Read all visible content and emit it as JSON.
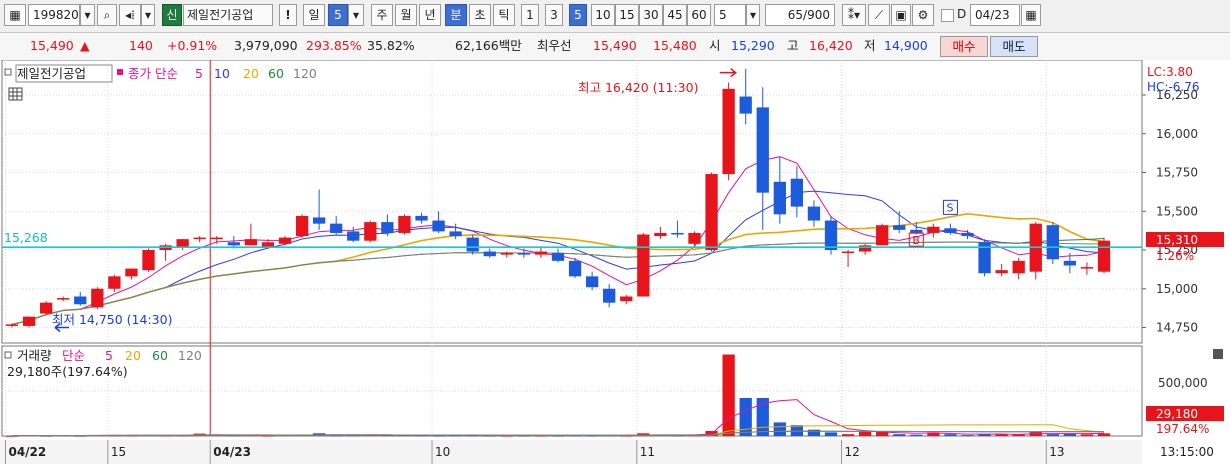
{
  "toolbar": {
    "code": "199820",
    "credit_badge": "신",
    "stock_name": "제일전기공업",
    "alert": "!",
    "periods": [
      "일",
      "5",
      "주",
      "월",
      "년",
      "분",
      "초",
      "틱"
    ],
    "active_period": "분",
    "minutes": [
      "1",
      "3",
      "5",
      "10",
      "15",
      "30",
      "45",
      "60"
    ],
    "active_minute": "5",
    "interval_value": "5",
    "count_display": "65/900",
    "date_checkbox_label": "D",
    "date_value": "04/23"
  },
  "quote": {
    "price": "15,490",
    "change": "140",
    "change_rate": "+0.91%",
    "volume": "3,979,090",
    "volume_ratio": "293.85%",
    "turnover": "35.82%",
    "amount": "62,166백만",
    "best_label": "최우선",
    "ask": "15,490",
    "bid": "15,480",
    "open_label": "시",
    "open": "15,290",
    "high_label": "고",
    "high": "16,420",
    "low_label": "저",
    "low": "14,900",
    "buy_label": "매수",
    "sell_label": "매도"
  },
  "price_panel": {
    "title": "제일전기공업",
    "ma_label": "종가 단순",
    "ma_periods": [
      "5",
      "10",
      "20",
      "60",
      "120"
    ],
    "ma_colors": [
      "#e0149c",
      "#2a3fe8",
      "#e8a800",
      "#1a8c3a",
      "#808080"
    ],
    "lc_label": "LC:3.80",
    "hc_label": "HC:-6.76",
    "max_annotation": "최고 16,420 (11:30)",
    "min_annotation": "최저 14,750 (14:30)",
    "ref_line_label": "15,268",
    "ref_line_value": 15268,
    "current_price_label": "15,310",
    "current_change_label": "1.26%",
    "signal_s": "S",
    "signal_b": "B",
    "y_ticks": [
      "16,250",
      "16,000",
      "15,750",
      "15,500",
      "15,250",
      "15,000",
      "14,750"
    ]
  },
  "volume_panel": {
    "title": "거래량",
    "ma_label": "단순",
    "ma_periods": [
      "5",
      "20",
      "60",
      "120"
    ],
    "ma_colors": [
      "#e0149c",
      "#e8a800",
      "#1a8c3a",
      "#808080"
    ],
    "last_value": "29,180주(197.64%)",
    "y_tick": "500,000",
    "current_label": "29,180",
    "ratio_label": "197.64%"
  },
  "x_axis": {
    "labels": [
      "04/22",
      "15",
      "04/23",
      "10",
      "11",
      "12",
      "13"
    ],
    "time": "13:15:00"
  },
  "chart_data": {
    "type": "candlestick",
    "interval": "5분",
    "ylim": [
      14650,
      16450
    ],
    "candles": [
      {
        "o": 14760,
        "h": 14775,
        "l": 14750,
        "c": 14770
      },
      {
        "o": 14760,
        "h": 14820,
        "l": 14750,
        "c": 14820
      },
      {
        "o": 14840,
        "h": 14920,
        "l": 14830,
        "c": 14910
      },
      {
        "o": 14930,
        "h": 14950,
        "l": 14920,
        "c": 14940
      },
      {
        "o": 14950,
        "h": 14980,
        "l": 14890,
        "c": 14900
      },
      {
        "o": 14880,
        "h": 15010,
        "l": 14870,
        "c": 15000
      },
      {
        "o": 15000,
        "h": 15090,
        "l": 14980,
        "c": 15080
      },
      {
        "o": 15080,
        "h": 15130,
        "l": 15060,
        "c": 15130
      },
      {
        "o": 15120,
        "h": 15260,
        "l": 15110,
        "c": 15250
      },
      {
        "o": 15250,
        "h": 15290,
        "l": 15180,
        "c": 15280
      },
      {
        "o": 15270,
        "h": 15320,
        "l": 15250,
        "c": 15320
      },
      {
        "o": 15320,
        "h": 15340,
        "l": 15300,
        "c": 15330
      },
      {
        "o": 15320,
        "h": 15340,
        "l": 15290,
        "c": 15330
      },
      {
        "o": 15300,
        "h": 15340,
        "l": 15260,
        "c": 15280
      },
      {
        "o": 15280,
        "h": 15420,
        "l": 15280,
        "c": 15320
      },
      {
        "o": 15270,
        "h": 15320,
        "l": 15260,
        "c": 15300
      },
      {
        "o": 15290,
        "h": 15340,
        "l": 15280,
        "c": 15330
      },
      {
        "o": 15340,
        "h": 15480,
        "l": 15330,
        "c": 15470
      },
      {
        "o": 15460,
        "h": 15640,
        "l": 15380,
        "c": 15420
      },
      {
        "o": 15420,
        "h": 15470,
        "l": 15350,
        "c": 15360
      },
      {
        "o": 15370,
        "h": 15400,
        "l": 15300,
        "c": 15310
      },
      {
        "o": 15310,
        "h": 15440,
        "l": 15300,
        "c": 15430
      },
      {
        "o": 15430,
        "h": 15480,
        "l": 15340,
        "c": 15360
      },
      {
        "o": 15360,
        "h": 15480,
        "l": 15350,
        "c": 15470
      },
      {
        "o": 15470,
        "h": 15490,
        "l": 15420,
        "c": 15440
      },
      {
        "o": 15440,
        "h": 15500,
        "l": 15360,
        "c": 15370
      },
      {
        "o": 15370,
        "h": 15420,
        "l": 15320,
        "c": 15340
      },
      {
        "o": 15330,
        "h": 15350,
        "l": 15220,
        "c": 15240
      },
      {
        "o": 15240,
        "h": 15260,
        "l": 15200,
        "c": 15210
      },
      {
        "o": 15220,
        "h": 15240,
        "l": 15200,
        "c": 15230
      },
      {
        "o": 15230,
        "h": 15260,
        "l": 15200,
        "c": 15220
      },
      {
        "o": 15220,
        "h": 15270,
        "l": 15200,
        "c": 15240
      },
      {
        "o": 15230,
        "h": 15260,
        "l": 15170,
        "c": 15180
      },
      {
        "o": 15180,
        "h": 15200,
        "l": 15070,
        "c": 15080
      },
      {
        "o": 15080,
        "h": 15110,
        "l": 14990,
        "c": 15010
      },
      {
        "o": 15000,
        "h": 15030,
        "l": 14880,
        "c": 14910
      },
      {
        "o": 14920,
        "h": 14960,
        "l": 14900,
        "c": 14950
      },
      {
        "o": 14950,
        "h": 15360,
        "l": 14950,
        "c": 15350
      },
      {
        "o": 15340,
        "h": 15400,
        "l": 15320,
        "c": 15360
      },
      {
        "o": 15360,
        "h": 15440,
        "l": 15330,
        "c": 15350
      },
      {
        "o": 15290,
        "h": 15370,
        "l": 15270,
        "c": 15360
      },
      {
        "o": 15250,
        "h": 15750,
        "l": 15240,
        "c": 15740
      },
      {
        "o": 15740,
        "h": 16330,
        "l": 15700,
        "c": 16290
      },
      {
        "o": 16240,
        "h": 16420,
        "l": 16060,
        "c": 16130
      },
      {
        "o": 16170,
        "h": 16300,
        "l": 15380,
        "c": 15620
      },
      {
        "o": 15690,
        "h": 15850,
        "l": 15420,
        "c": 15480
      },
      {
        "o": 15710,
        "h": 15790,
        "l": 15460,
        "c": 15530
      },
      {
        "o": 15530,
        "h": 15570,
        "l": 15400,
        "c": 15440
      },
      {
        "o": 15440,
        "h": 15470,
        "l": 15220,
        "c": 15250
      },
      {
        "o": 15230,
        "h": 15250,
        "l": 15140,
        "c": 15240
      },
      {
        "o": 15240,
        "h": 15290,
        "l": 15220,
        "c": 15280
      },
      {
        "o": 15280,
        "h": 15420,
        "l": 15280,
        "c": 15410
      },
      {
        "o": 15410,
        "h": 15500,
        "l": 15360,
        "c": 15380
      },
      {
        "o": 15380,
        "h": 15430,
        "l": 15350,
        "c": 15360
      },
      {
        "o": 15360,
        "h": 15420,
        "l": 15330,
        "c": 15400
      },
      {
        "o": 15390,
        "h": 15420,
        "l": 15350,
        "c": 15360
      },
      {
        "o": 15360,
        "h": 15380,
        "l": 15320,
        "c": 15340
      },
      {
        "o": 15300,
        "h": 15320,
        "l": 15080,
        "c": 15100
      },
      {
        "o": 15100,
        "h": 15160,
        "l": 15080,
        "c": 15120
      },
      {
        "o": 15100,
        "h": 15200,
        "l": 15060,
        "c": 15180
      },
      {
        "o": 15110,
        "h": 15430,
        "l": 15060,
        "c": 15420
      },
      {
        "o": 15410,
        "h": 15430,
        "l": 15160,
        "c": 15190
      },
      {
        "o": 15180,
        "h": 15230,
        "l": 15100,
        "c": 15150
      },
      {
        "o": 15130,
        "h": 15170,
        "l": 15090,
        "c": 15140
      },
      {
        "o": 15110,
        "h": 15330,
        "l": 15100,
        "c": 15310
      }
    ],
    "volumes": [
      2200,
      7000,
      4000,
      9000,
      4200,
      9800,
      8000,
      7500,
      10500,
      6000,
      7000,
      26000,
      14500,
      7000,
      8500,
      5000,
      10000,
      15000,
      30000,
      7000,
      8000,
      12000,
      9000,
      10000,
      8000,
      5000,
      6000,
      7000,
      5000,
      4500,
      5000,
      5000,
      4500,
      6000,
      5000,
      7000,
      5000,
      30000,
      12500,
      7000,
      8000,
      55000,
      900000,
      420000,
      420000,
      150000,
      120000,
      70000,
      40000,
      20000,
      50000,
      45000,
      20000,
      15000,
      40000,
      20000,
      10000,
      20000,
      20000,
      20000,
      50000,
      20000,
      25000,
      18000,
      29180
    ]
  }
}
